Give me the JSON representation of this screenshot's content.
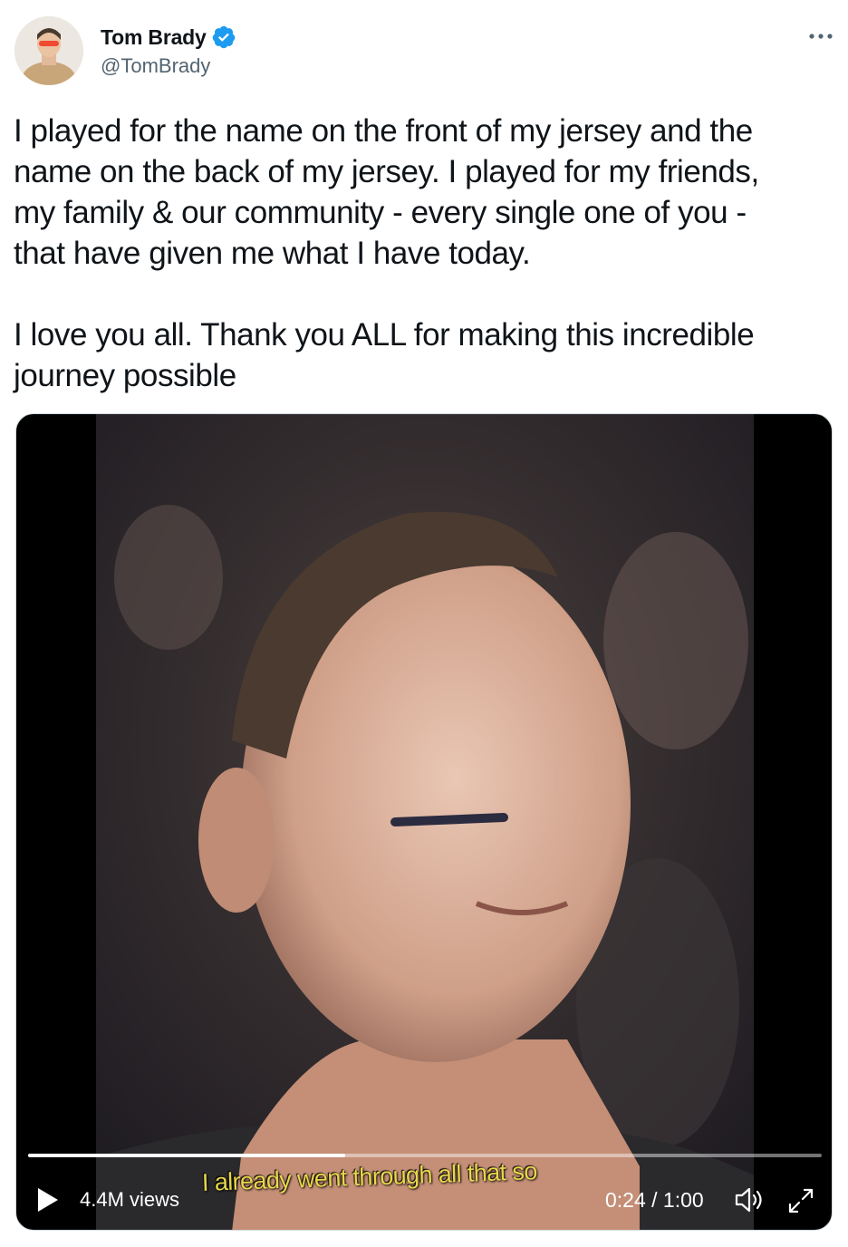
{
  "tweet": {
    "author": {
      "name": "Tom Brady",
      "handle": "@TomBrady",
      "verified": true,
      "verified_color": "#1d9bf0"
    },
    "text": {
      "paragraph1": [
        "I played for the name on the front of my jersey and the",
        "name on the back of my jersey. I played for my friends,",
        "my family & our community - every single one of you -",
        "that have given me what I have today."
      ],
      "paragraph2": [
        "I love you all. Thank you ALL for making this incredible",
        "journey possible"
      ]
    },
    "video": {
      "views": "4.4M views",
      "subtitle": "I already went through all that so",
      "time": "0:24 / 1:00",
      "progress": 0.4
    }
  }
}
